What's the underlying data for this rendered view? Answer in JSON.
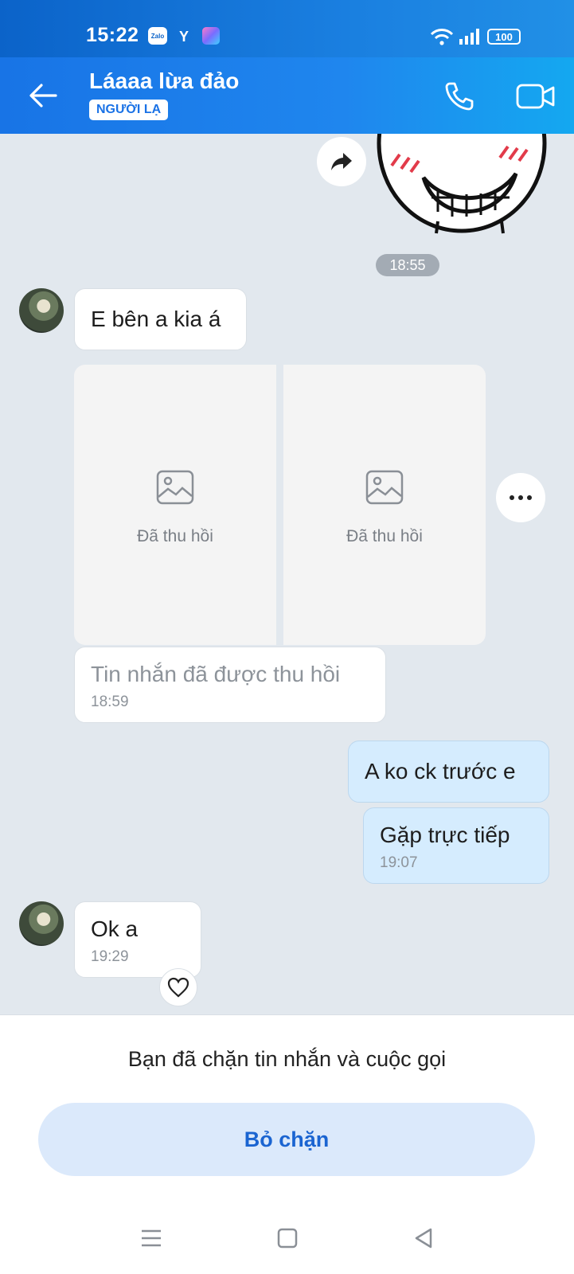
{
  "status_bar": {
    "time": "15:22",
    "zalo_icon_text": "Zalo",
    "y_icon_text": "Y",
    "battery": "100"
  },
  "header": {
    "title": "Láaaa lừa đảo",
    "badge": "NGƯỜI LẠ"
  },
  "chat": {
    "time_divider": "18:55",
    "messages": [
      {
        "sender": "them",
        "text": "E bên a kia á"
      },
      {
        "sender": "them",
        "type": "recalled_images",
        "labels": [
          "Đã thu hồi",
          "Đã thu hồi"
        ]
      },
      {
        "sender": "them",
        "text": "Tin nhắn đã được thu hồi",
        "time": "18:59"
      },
      {
        "sender": "me",
        "text": "A ko ck trước e"
      },
      {
        "sender": "me",
        "text": "Gặp trực tiếp",
        "time": "19:07"
      },
      {
        "sender": "them",
        "text": "Ok a",
        "time": "19:29"
      }
    ]
  },
  "bottom": {
    "blocked_notice": "Bạn đã chặn tin nhắn và cuộc gọi",
    "unblock_label": "Bỏ chặn"
  },
  "colors": {
    "header_start": "#1874e6",
    "header_end": "#14a8f0",
    "my_bubble": "#d5ecfe",
    "accent": "#1a64d1"
  }
}
